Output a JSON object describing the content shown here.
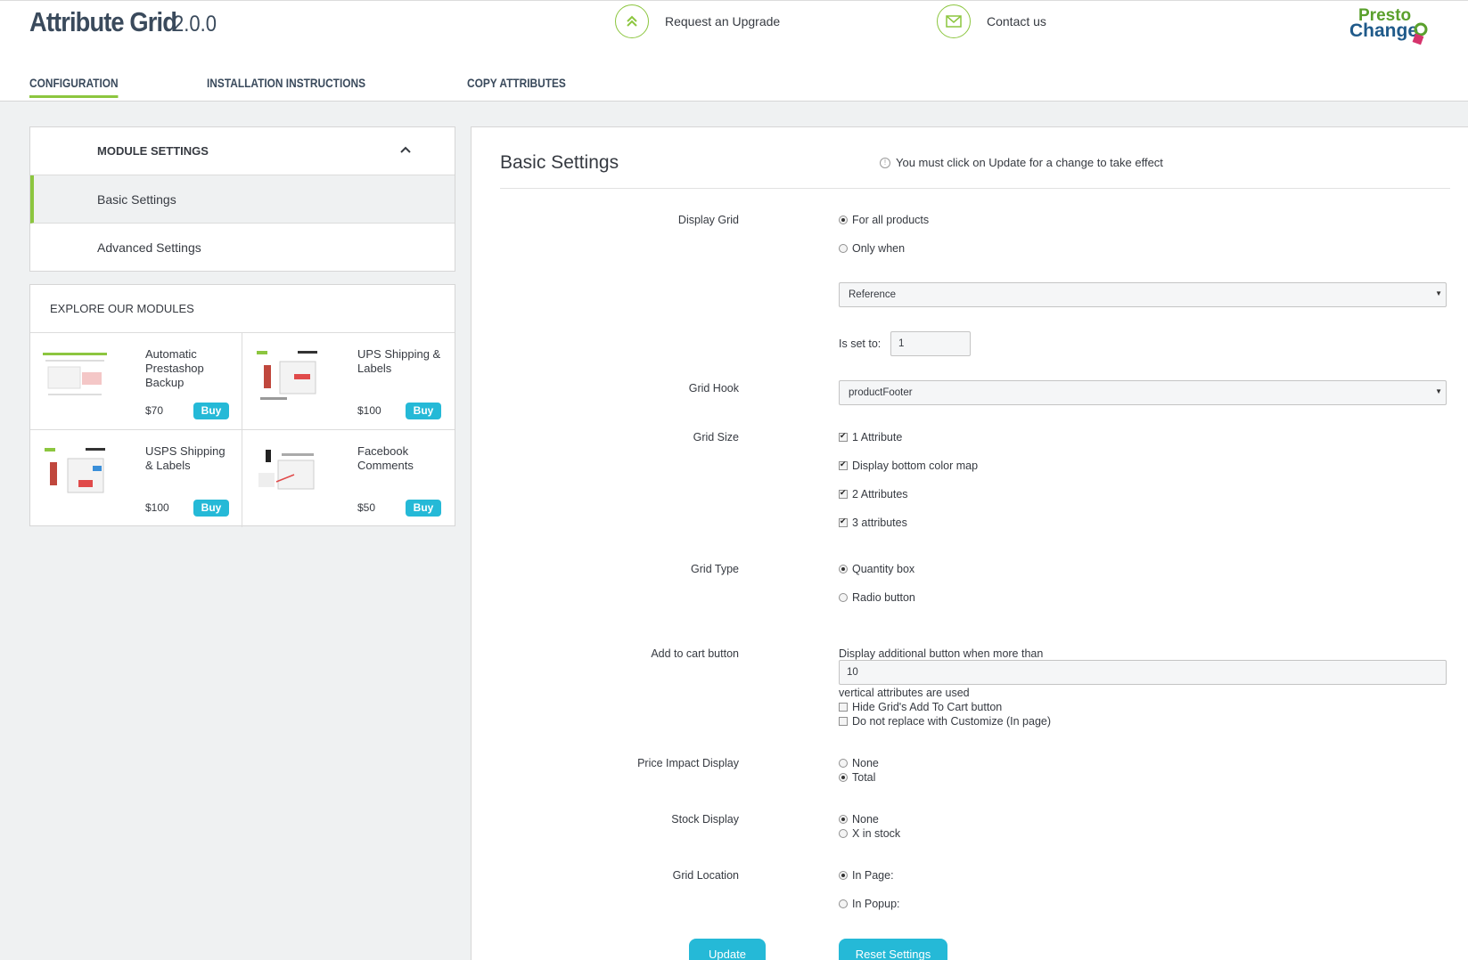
{
  "header": {
    "title": "Attribute Grid",
    "version": "2.0.0",
    "upgrade_label": "Request an Upgrade",
    "contact_label": "Contact us",
    "logo_text_top": "Presto",
    "logo_text_bottom": "Change",
    "accent": "#8cc63f"
  },
  "tabs": [
    {
      "label": "CONFIGURATION"
    },
    {
      "label": "INSTALLATION INSTRUCTIONS"
    },
    {
      "label": "COPY ATTRIBUTES"
    }
  ],
  "sidebar": {
    "heading": "MODULE SETTINGS",
    "items": [
      {
        "label": "Basic Settings"
      },
      {
        "label": "Advanced Settings"
      }
    ]
  },
  "explore": {
    "heading": "EXPLORE OUR MODULES",
    "buy_label": "Buy",
    "modules": [
      {
        "name": "Automatic Prestashop Backup",
        "price": "$70"
      },
      {
        "name": "UPS Shipping & Labels",
        "price": "$100"
      },
      {
        "name": "USPS Shipping & Labels",
        "price": "$100"
      },
      {
        "name": "Facebook Comments",
        "price": "$50"
      }
    ]
  },
  "main": {
    "title": "Basic Settings",
    "notice": "You must click on Update for a change to take effect",
    "display_grid": {
      "label": "Display Grid",
      "opt1": "For all products",
      "opt2": "Only when",
      "select_value": "Reference",
      "is_set_label": "Is set to:",
      "is_set_value": "1"
    },
    "grid_hook": {
      "label": "Grid Hook",
      "value": "productFooter"
    },
    "grid_size": {
      "label": "Grid Size",
      "opts": [
        "1 Attribute",
        "Display bottom color map",
        "2 Attributes",
        "3 attributes"
      ]
    },
    "grid_type": {
      "label": "Grid Type",
      "opt1": "Quantity box",
      "opt2": "Radio button"
    },
    "add_to_cart": {
      "label": "Add to cart button",
      "text_before": "Display additional button when more than",
      "value": "10",
      "text_after": "vertical attributes are used",
      "check1": "Hide Grid's Add To Cart button",
      "check2": "Do not replace with Customize (In page)"
    },
    "price_impact": {
      "label": "Price Impact Display",
      "opt1": "None",
      "opt2": "Total"
    },
    "stock_display": {
      "label": "Stock Display",
      "opt1": "None",
      "opt2": "X in stock"
    },
    "grid_location": {
      "label": "Grid Location",
      "opt1": "In Page:",
      "opt2": "In Popup:"
    },
    "update_label": "Update",
    "reset_label": "Reset Settings"
  }
}
